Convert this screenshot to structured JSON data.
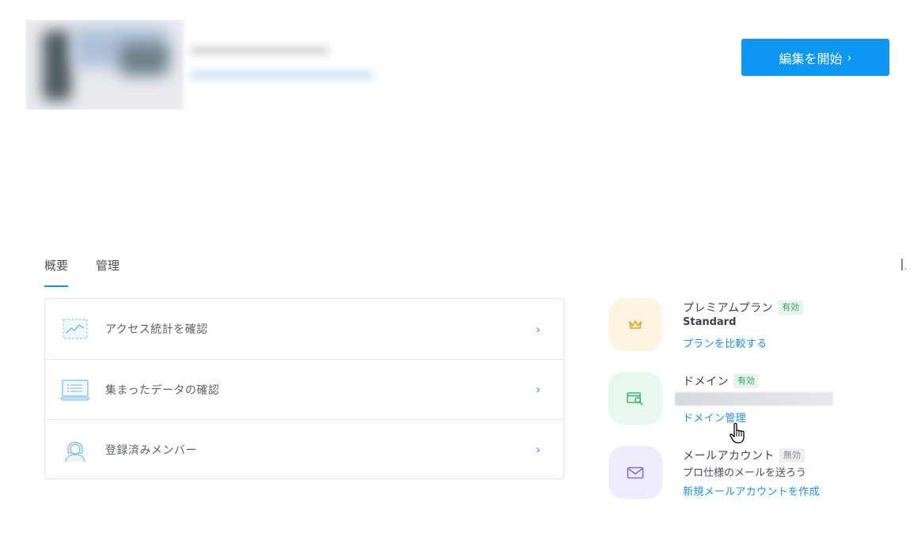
{
  "header": {
    "edit_button_label": "編集を開始",
    "edit_button_chevron": "›",
    "accent_color": "#0d96f2"
  },
  "tabs": [
    {
      "label": "概要",
      "active": true
    },
    {
      "label": "管理",
      "active": false
    }
  ],
  "actions": [
    {
      "label": "アクセス統計を確認",
      "icon": "chart-icon",
      "chevron": "›"
    },
    {
      "label": "集まったデータの確認",
      "icon": "laptop-list-icon",
      "chevron": "›"
    },
    {
      "label": "登録済みメンバー",
      "icon": "member-icon",
      "chevron": "›"
    }
  ],
  "services": {
    "premium": {
      "title": "プレミアムプラン",
      "badge": "有効",
      "plan": "Standard",
      "link": "プランを比較する",
      "icon": "crown-icon",
      "tile_color": "#fff3e2"
    },
    "domain": {
      "title": "ドメイン",
      "badge": "有効",
      "link": "ドメイン管理",
      "icon": "domain-search-icon",
      "tile_color": "#e8f8ee"
    },
    "mail": {
      "title": "メールアカウント",
      "badge": "無効",
      "description": "プロ仕様のメールを送ろう",
      "link": "新規メールアカウントを作成",
      "icon": "mail-icon",
      "tile_color": "#eeecfd"
    }
  }
}
